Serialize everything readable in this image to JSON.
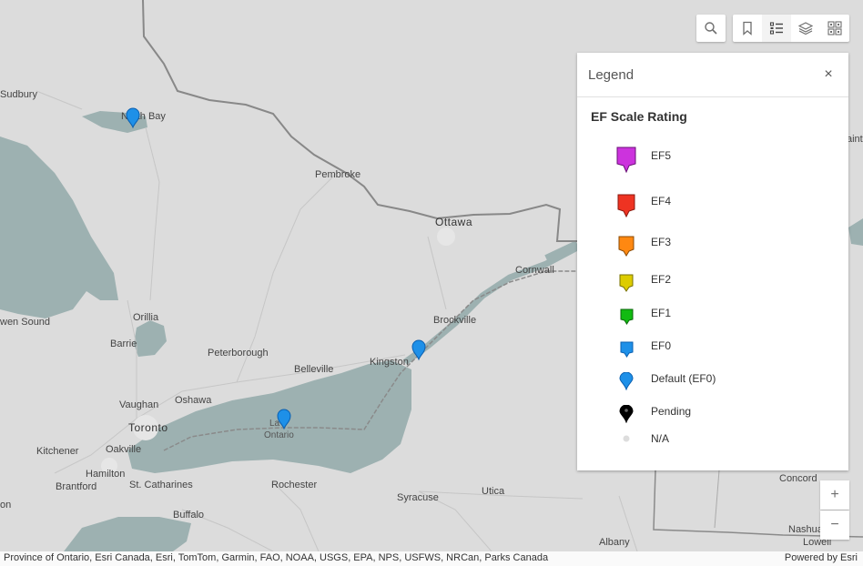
{
  "map": {
    "labels": {
      "sudbury": "Sudbury",
      "north_bay": "North Bay",
      "pembroke": "Pembroke",
      "ottawa": "Ottawa",
      "cornwall": "Cornwall",
      "brockville": "Brockville",
      "kingston": "Kingston",
      "belleville": "Belleville",
      "peterborough": "Peterborough",
      "orillia": "Orillia",
      "barrie": "Barrie",
      "owen_sound": "wen Sound",
      "oshawa": "Oshawa",
      "vaughan": "Vaughan",
      "toronto": "Toronto",
      "kitchener": "Kitchener",
      "oakville": "Oakville",
      "hamilton": "Hamilton",
      "brantford": "Brantford",
      "st_catharines": "St. Catharines",
      "buffalo": "Buffalo",
      "rochester": "Rochester",
      "syracuse": "Syracuse",
      "utica": "Utica",
      "albany": "Albany",
      "concord": "Concord",
      "nashua": "Nashua",
      "lowell": "Lowell",
      "lake_ontario_a": "La",
      "lake_ontario_b": "Ontario",
      "edge_left": "on",
      "edge_right": "aint-"
    },
    "markers": [
      {
        "name": "North Bay area",
        "color": "#1e90e8"
      },
      {
        "name": "Kingston area",
        "color": "#1e90e8"
      },
      {
        "name": "Lake Ontario",
        "color": "#1e90e8"
      }
    ]
  },
  "toolbar": {
    "search_icon": "search-icon",
    "bookmark_icon": "bookmark-icon",
    "legend_icon": "legend-list-icon",
    "layers_icon": "layers-icon",
    "basemap_icon": "basemap-gallery-icon"
  },
  "legend": {
    "title": "Legend",
    "close_glyph": "×",
    "layer_title": "EF Scale Rating",
    "items": [
      {
        "label": "EF5",
        "color": "#cc33dd"
      },
      {
        "label": "EF4",
        "color": "#ee3322"
      },
      {
        "label": "EF3",
        "color": "#ff8811"
      },
      {
        "label": "EF2",
        "color": "#ddcc00"
      },
      {
        "label": "EF1",
        "color": "#11bb11"
      },
      {
        "label": "EF0",
        "color": "#1e90e8"
      },
      {
        "label": "Default (EF0)",
        "color": "#1e90e8"
      },
      {
        "label": "Pending",
        "color": "#000000"
      },
      {
        "label": "N/A",
        "color": "#dddddd"
      }
    ]
  },
  "zoom": {
    "in": "+",
    "out": "−"
  },
  "attribution": {
    "text": "Province of Ontario, Esri Canada, Esri, TomTom, Garmin, FAO, NOAA, USGS, EPA, NPS, USFWS, NRCan, Parks Canada",
    "powered": "Powered by Esri"
  }
}
